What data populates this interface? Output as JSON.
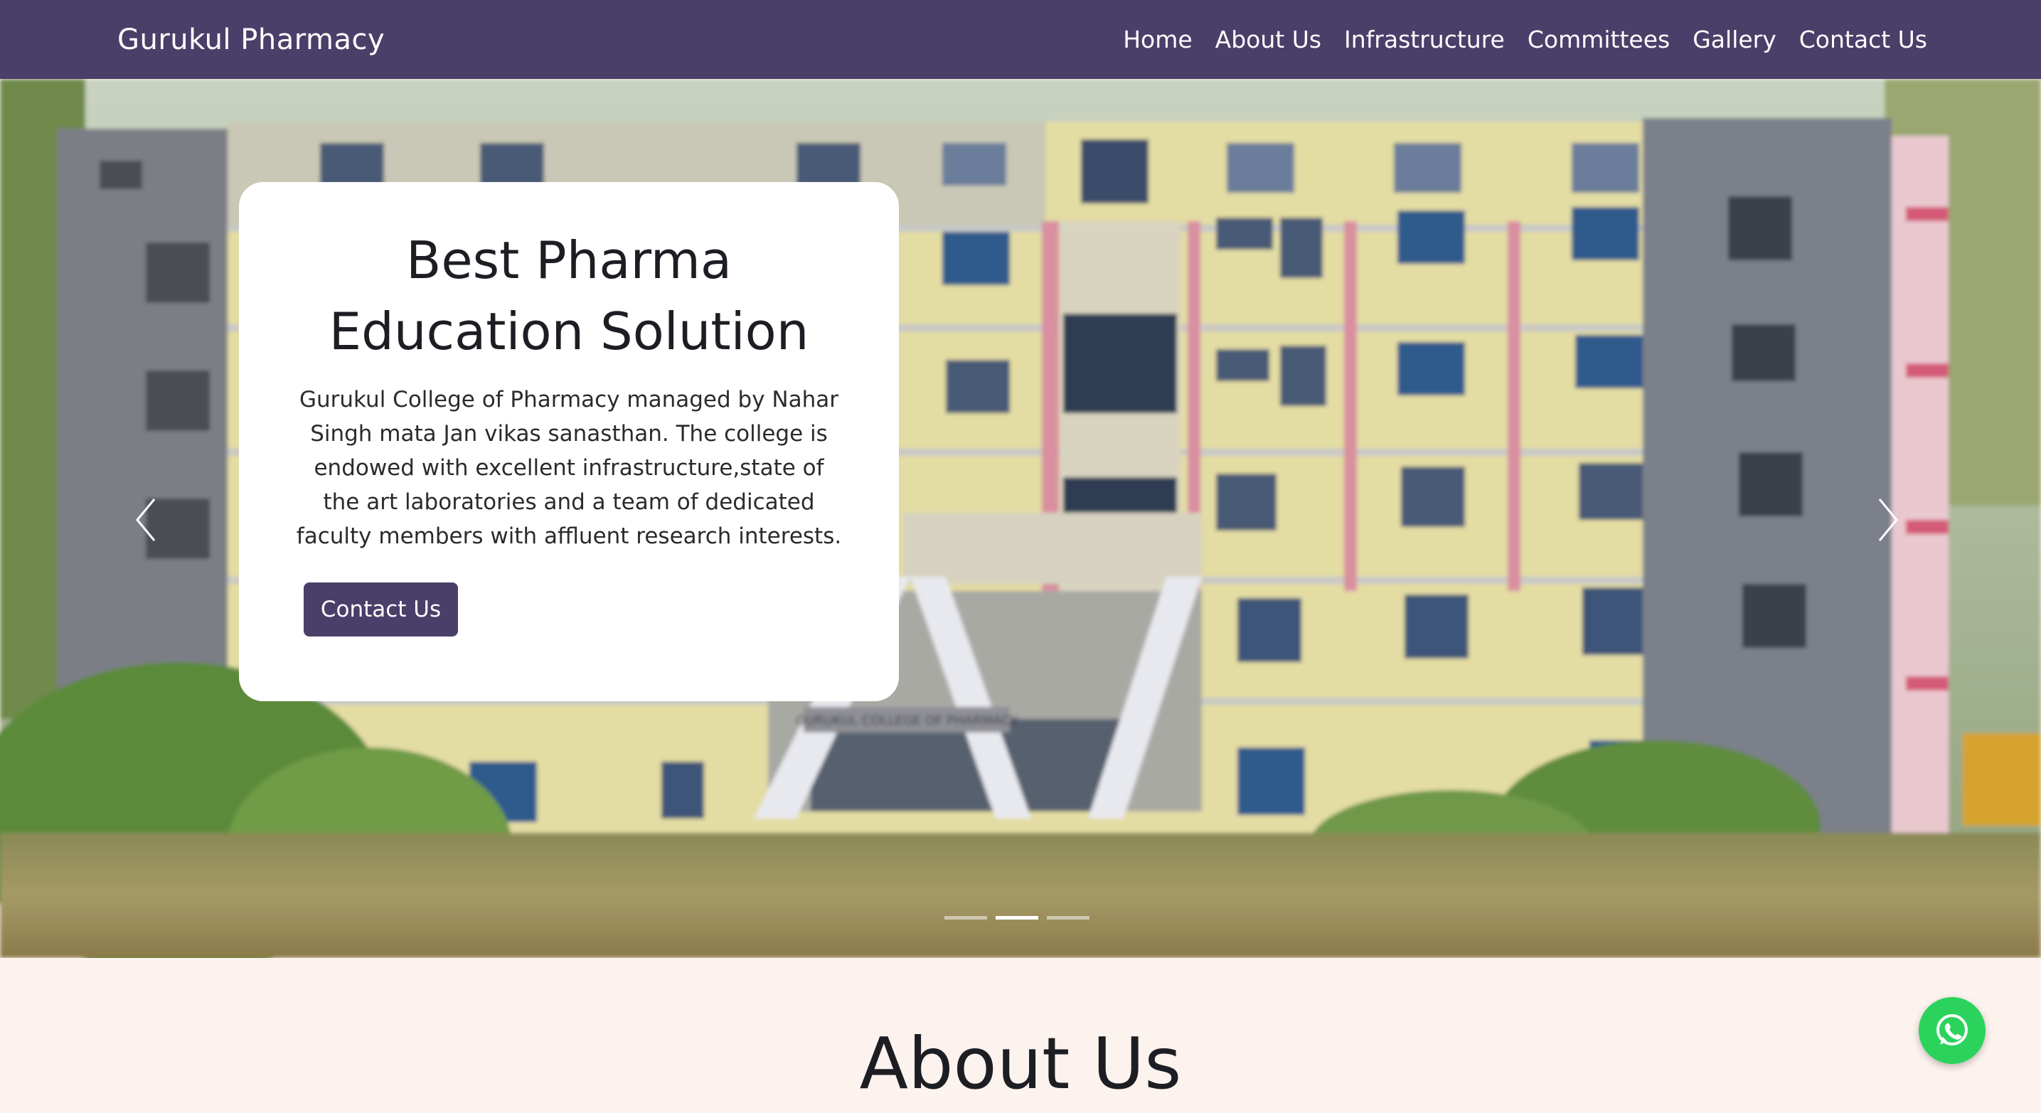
{
  "navbar": {
    "brand": "Gurukul Pharmacy",
    "links": [
      "Home",
      "About Us",
      "Infrastructure",
      "Committees",
      "Gallery",
      "Contact Us"
    ]
  },
  "hero": {
    "title": "Best Pharma Education Solution",
    "description": "Gurukul College of Pharmacy managed by Nahar Singh mata Jan vikas sanasthan. The college is endowed with excellent infrastructure,state of the art laboratories and a team of dedicated faculty members with affluent research interests.",
    "button_label": "Contact Us",
    "building_sign": "GURUKUL COLLEGE OF PHARMACY",
    "carousel": {
      "slide_count": 3,
      "active_slide": 2
    }
  },
  "about": {
    "title": "About Us"
  },
  "icons": {
    "prev": "chevron-left-icon",
    "next": "chevron-right-icon",
    "whatsapp": "whatsapp-icon"
  },
  "colors": {
    "brand": "#4a3f69",
    "section_background": "#fdf3ee",
    "whatsapp": "#2bd35d"
  }
}
